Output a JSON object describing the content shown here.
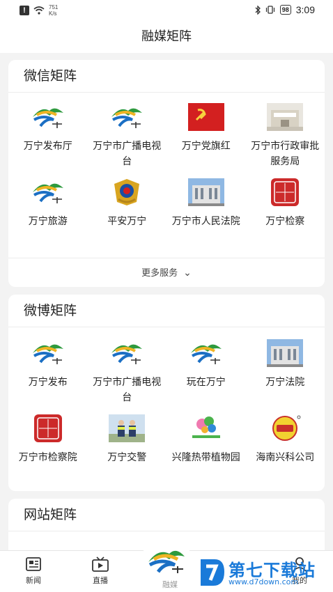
{
  "status": {
    "speed_value": "751",
    "speed_unit": "K/s",
    "battery": "98",
    "time": "3:09"
  },
  "page_title": "融媒矩阵",
  "wechat": {
    "title": "微信矩阵",
    "items": [
      {
        "label": "万宁发布厅",
        "icon": "wanning-logo-icon"
      },
      {
        "label": "万宁市广播电视台",
        "icon": "wanning-logo-icon"
      },
      {
        "label": "万宁党旗红",
        "icon": "party-flag-icon"
      },
      {
        "label": "万宁市行政审批服务局",
        "icon": "building-icon"
      },
      {
        "label": "万宁旅游",
        "icon": "wanning-logo-icon"
      },
      {
        "label": "平安万宁",
        "icon": "police-badge-icon"
      },
      {
        "label": "万宁市人民法院",
        "icon": "court-building-icon"
      },
      {
        "label": "万宁检察",
        "icon": "procuratorate-seal-icon"
      }
    ],
    "more_label": "更多服务"
  },
  "weibo": {
    "title": "微博矩阵",
    "items": [
      {
        "label": "万宁发布",
        "icon": "wanning-logo-icon"
      },
      {
        "label": "万宁市广播电视台",
        "icon": "wanning-logo-icon"
      },
      {
        "label": "玩在万宁",
        "icon": "wanning-logo-icon"
      },
      {
        "label": "万宁法院",
        "icon": "court-building-icon"
      },
      {
        "label": "万宁市检察院",
        "icon": "procuratorate-seal-icon"
      },
      {
        "label": "万宁交警",
        "icon": "traffic-police-photo-icon"
      },
      {
        "label": "兴隆热带植物园",
        "icon": "botanical-garden-logo-icon"
      },
      {
        "label": "海南兴科公司",
        "icon": "xingke-logo-icon"
      }
    ]
  },
  "website": {
    "title": "网站矩阵"
  },
  "tabbar": {
    "news_label": "新闻",
    "live_label": "直播",
    "media_label": "融媒",
    "mine_label": "我的"
  },
  "watermark": {
    "text": "第七下载站",
    "url": "www.d7down.com"
  },
  "colors": {
    "accent_blue": "#1a7ad9",
    "party_red": "#d32020",
    "seal_red": "#cc2a2a"
  }
}
